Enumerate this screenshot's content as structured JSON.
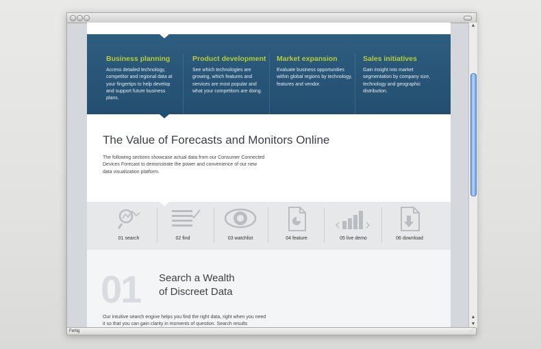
{
  "window": {
    "status_text": "Fertig"
  },
  "hero": {
    "columns": [
      {
        "title": "Business planning",
        "text": "Access detailed technology, competitor and regional data at your fingertips to help develop and support future business plans."
      },
      {
        "title": "Product development",
        "text": "See which technologies are growing, which features and services are most popular and what your competitors are doing."
      },
      {
        "title": "Market expansion",
        "text": "Evaluate business opportunities within global regions by technology, features and vendor."
      },
      {
        "title": "Sales initiatives",
        "text": "Gain insight into market segmentation by company size, technology and geographic distribution."
      }
    ]
  },
  "value": {
    "title": "The Value of Forecasts and Monitors Online",
    "text": "The following sections showcase actual data from our Consumer Connected Devices Forecast to demonstrate the power and convenience of our new data visualization platform."
  },
  "tabs": [
    {
      "label": "01 search",
      "icon": "search-chart-icon"
    },
    {
      "label": "02 find",
      "icon": "list-check-icon"
    },
    {
      "label": "03 watchlist",
      "icon": "eye-icon"
    },
    {
      "label": "04 feature",
      "icon": "document-pie-icon"
    },
    {
      "label": "05 live demo",
      "icon": "bar-chart-icon"
    },
    {
      "label": "06 download",
      "icon": "download-document-icon"
    }
  ],
  "section": {
    "number": "01",
    "title_line1": "Search a Wealth",
    "title_line2": "of Discreet Data",
    "text": "Our intuitive search engine helps you find the right data, right when you need it so that you can gain clarity in moments of question. Search results"
  },
  "colors": {
    "hero_bg": "#275676",
    "accent": "#b7cc36",
    "tabs_bg": "#e6e8ea"
  }
}
